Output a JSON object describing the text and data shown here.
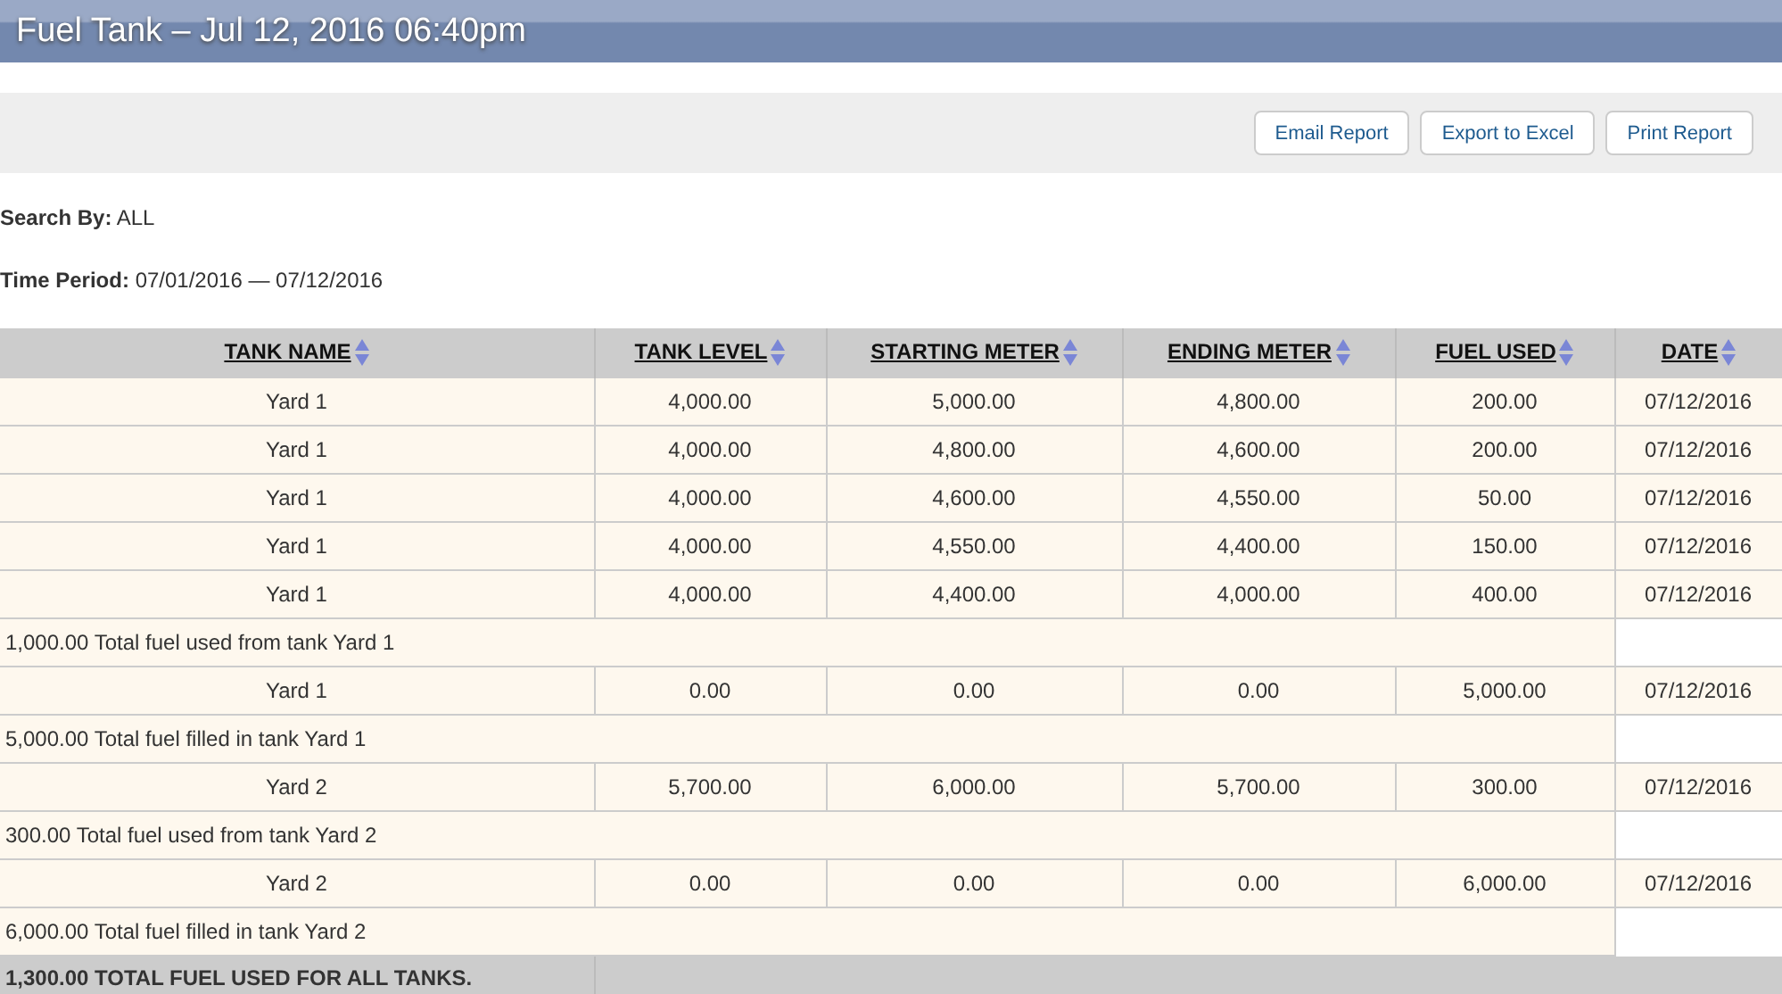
{
  "window": {
    "title": "Fuel Tank – Jul 12, 2016 06:40pm"
  },
  "toolbar": {
    "buttons": [
      "Email Report",
      "Export to Excel",
      "Print Report"
    ]
  },
  "filters": [
    {
      "label": "Search By:",
      "value": "ALL"
    },
    {
      "label": "Time Period:",
      "value": "07/01/2016 — 07/12/2016"
    }
  ],
  "table": {
    "columns": [
      "TANK NAME",
      "TANK LEVEL",
      "STARTING METER",
      "ENDING METER",
      "FUEL USED",
      "DATE"
    ],
    "rows": [
      {
        "kind": "entry",
        "cells": [
          "Yard 1",
          "4,000.00",
          "5,000.00",
          "4,800.00",
          "200.00",
          "07/12/2016"
        ]
      },
      {
        "kind": "entry",
        "cells": [
          "Yard 1",
          "4,000.00",
          "4,800.00",
          "4,600.00",
          "200.00",
          "07/12/2016"
        ]
      },
      {
        "kind": "entry",
        "cells": [
          "Yard 1",
          "4,000.00",
          "4,600.00",
          "4,550.00",
          "50.00",
          "07/12/2016"
        ]
      },
      {
        "kind": "entry",
        "cells": [
          "Yard 1",
          "4,000.00",
          "4,550.00",
          "4,400.00",
          "150.00",
          "07/12/2016"
        ]
      },
      {
        "kind": "entry",
        "cells": [
          "Yard 1",
          "4,000.00",
          "4,400.00",
          "4,000.00",
          "400.00",
          "07/12/2016"
        ]
      },
      {
        "kind": "summary",
        "text": "1,000.00 Total fuel used from tank Yard 1"
      },
      {
        "kind": "entry",
        "cells": [
          "Yard 1",
          "0.00",
          "0.00",
          "0.00",
          "5,000.00",
          "07/12/2016"
        ]
      },
      {
        "kind": "summary",
        "text": "5,000.00 Total fuel filled in tank Yard 1"
      },
      {
        "kind": "entry",
        "cells": [
          "Yard 2",
          "5,700.00",
          "6,000.00",
          "5,700.00",
          "300.00",
          "07/12/2016"
        ]
      },
      {
        "kind": "summary",
        "text": "300.00 Total fuel used from tank Yard 2"
      },
      {
        "kind": "entry",
        "cells": [
          "Yard 2",
          "0.00",
          "0.00",
          "0.00",
          "6,000.00",
          "07/12/2016"
        ]
      },
      {
        "kind": "summary",
        "text": "6,000.00 Total fuel filled in tank Yard 2"
      },
      {
        "kind": "total",
        "text": "1,300.00 TOTAL FUEL USED FOR ALL TANKS."
      }
    ]
  }
}
